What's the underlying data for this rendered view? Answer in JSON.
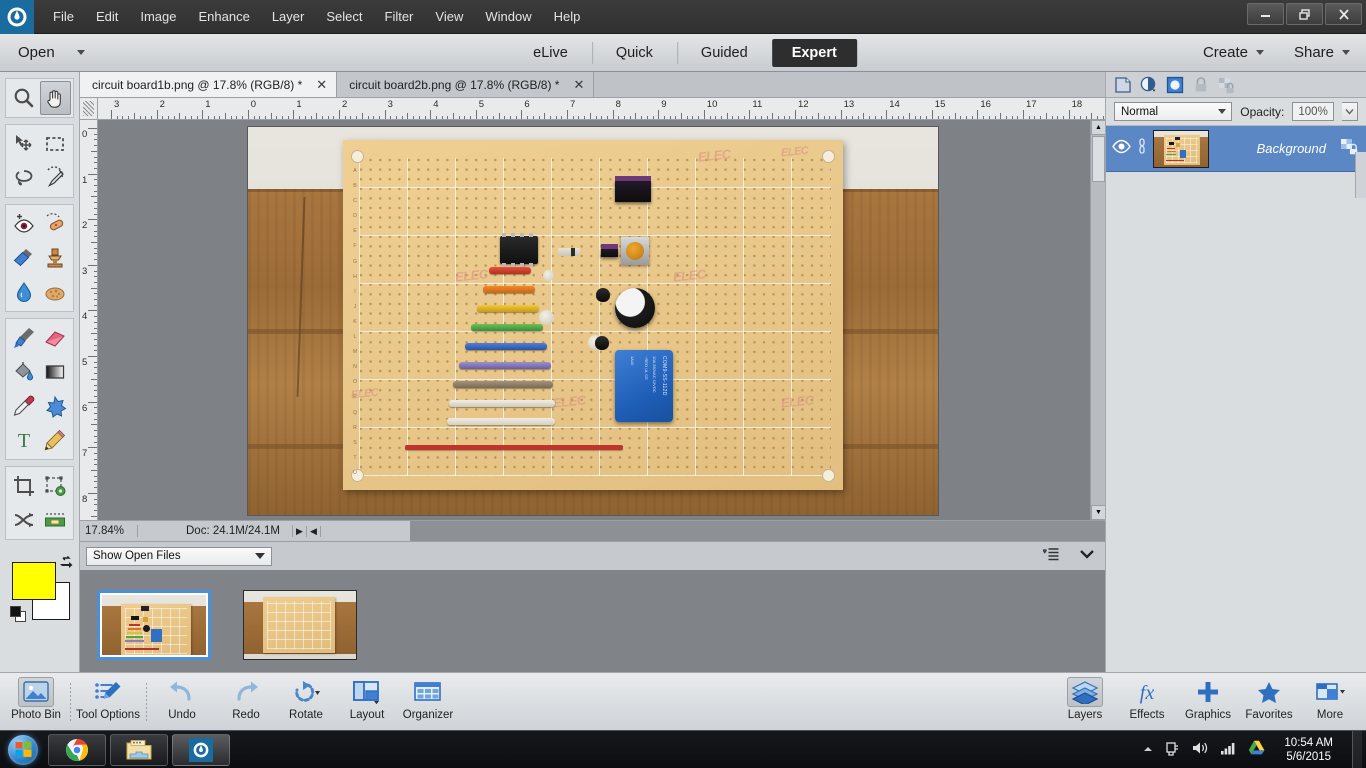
{
  "app": {
    "title": "Adobe Photoshop Elements",
    "logo_icon": "photoshop-elements-logo"
  },
  "menubar": {
    "items": [
      "File",
      "Edit",
      "Image",
      "Enhance",
      "Layer",
      "Select",
      "Filter",
      "View",
      "Window",
      "Help"
    ],
    "window_controls": [
      "minimize",
      "restore",
      "close"
    ]
  },
  "modebar": {
    "open_label": "Open",
    "tabs": [
      {
        "label": "eLive",
        "active": false
      },
      {
        "label": "Quick",
        "active": false
      },
      {
        "label": "Guided",
        "active": false
      },
      {
        "label": "Expert",
        "active": true
      }
    ],
    "create_label": "Create",
    "share_label": "Share"
  },
  "toolbar": {
    "groups": [
      {
        "tools": [
          {
            "name": "zoom-tool",
            "icon": "magnifier-icon",
            "active": false
          },
          {
            "name": "hand-tool",
            "icon": "hand-icon",
            "active": true
          }
        ]
      },
      {
        "tools": [
          {
            "name": "move-tool",
            "icon": "move-arrows-icon",
            "active": false
          },
          {
            "name": "rectangular-marquee-tool",
            "icon": "dashed-rectangle-icon",
            "active": false
          },
          {
            "name": "lasso-tool",
            "icon": "lasso-icon",
            "active": false
          },
          {
            "name": "quick-selection-tool",
            "icon": "magic-wand-icon",
            "active": false
          }
        ]
      },
      {
        "tools": [
          {
            "name": "red-eye-removal-tool",
            "icon": "eye-plus-icon",
            "active": false
          },
          {
            "name": "spot-healing-brush-tool",
            "icon": "healing-bandage-icon",
            "active": false
          },
          {
            "name": "smart-brush-tool",
            "icon": "paint-brush-blue-icon",
            "active": false
          },
          {
            "name": "clone-stamp-tool",
            "icon": "rubber-stamp-icon",
            "active": false
          },
          {
            "name": "blur-tool",
            "icon": "water-drop-icon",
            "active": false
          },
          {
            "name": "sponge-tool",
            "icon": "sponge-icon",
            "active": false
          }
        ]
      },
      {
        "tools": [
          {
            "name": "brush-tool",
            "icon": "paintbrush-icon",
            "active": false
          },
          {
            "name": "eraser-tool",
            "icon": "eraser-icon",
            "active": false
          },
          {
            "name": "paint-bucket-tool",
            "icon": "paint-bucket-icon",
            "active": false
          },
          {
            "name": "gradient-tool",
            "icon": "gradient-square-icon",
            "active": false
          },
          {
            "name": "color-picker-tool",
            "icon": "eyedropper-icon",
            "active": false
          },
          {
            "name": "custom-shape-tool",
            "icon": "blue-star-shape-icon",
            "active": false
          },
          {
            "name": "type-tool",
            "icon": "letter-t-icon",
            "active": false
          },
          {
            "name": "pencil-tool",
            "icon": "pencil-icon",
            "active": false
          }
        ]
      },
      {
        "tools": [
          {
            "name": "crop-tool",
            "icon": "crop-icon",
            "active": false
          },
          {
            "name": "recompose-tool",
            "icon": "transform-gear-icon",
            "active": false
          },
          {
            "name": "content-aware-move-tool",
            "icon": "swap-arrows-icon",
            "active": false
          },
          {
            "name": "straighten-tool",
            "icon": "straighten-level-icon",
            "active": false
          }
        ]
      }
    ],
    "colors": {
      "foreground": "#ffff00",
      "background": "#ffffff",
      "swap_icon": "swap-colors-icon",
      "default_icon": "default-colors-icon"
    }
  },
  "document_tabs": [
    {
      "label": "circuit board1b.png @ 17.8% (RGB/8) *",
      "active": true,
      "close_icon": "close-icon"
    },
    {
      "label": "circuit board2b.png @ 17.8% (RGB/8) *",
      "active": false,
      "close_icon": "close-icon"
    }
  ],
  "rulers": {
    "unit": "inches",
    "horizontal_labels": [
      "3",
      "2",
      "1",
      "0",
      "1",
      "2",
      "3",
      "4",
      "5",
      "6",
      "7",
      "8",
      "9",
      "10",
      "11",
      "12",
      "13",
      "14",
      "15",
      "16",
      "17",
      "18"
    ],
    "vertical_labels": [
      "0",
      "1",
      "2",
      "3",
      "4",
      "5",
      "6",
      "7",
      "8"
    ]
  },
  "canvas": {
    "image_name": "circuit board1b.png",
    "description": "Photo of a perfboard / prototyping circuit board with components, lying on wooden planks",
    "board_label_letters": "ABCDEFGHIJKLMNOPQRSTU",
    "components": [
      {
        "name": "dip-ic-chip",
        "type": "ic"
      },
      {
        "name": "black-rectangular-component",
        "type": "block"
      },
      {
        "name": "trimmer-potentiometer",
        "type": "trimmer"
      },
      {
        "name": "electrolytic-capacitor",
        "type": "elec"
      },
      {
        "name": "blue-box-capacitor",
        "type": "bluecap",
        "text": "COM9-SS-112D"
      },
      {
        "name": "ceramic-disc-capacitor",
        "type": "disc"
      },
      {
        "name": "diode",
        "type": "diode"
      },
      {
        "name": "transistor-to92",
        "type": "to92"
      }
    ],
    "resistor_colors": [
      "#c0352b",
      "#d9561f",
      "#e8a317",
      "#d9dc3b",
      "#4aa84a",
      "#3f6fc4",
      "#8b7fb8",
      "#7a6a58",
      "#d8d4c9"
    ]
  },
  "statusbar": {
    "zoom": "17.84%",
    "doc_info": "Doc: 24.1M/24.1M",
    "menu_icon": "triangle-right-icon",
    "scroll_icon": "triangle-left-icon"
  },
  "photobin": {
    "filter_label": "Show Open Files",
    "options_icon": "panel-menu-icon",
    "collapse_icon": "chevron-down-icon",
    "thumbnails": [
      {
        "name": "circuit board1b.png",
        "selected": true
      },
      {
        "name": "circuit board2b.png",
        "selected": false
      }
    ]
  },
  "layers_panel": {
    "toolbar_icons": [
      {
        "name": "new-layer-icon"
      },
      {
        "name": "adjustment-layer-icon"
      },
      {
        "name": "layer-mask-icon"
      },
      {
        "name": "lock-icon"
      },
      {
        "name": "lock-transparency-icon"
      },
      {
        "name": "delete-layer-icon"
      },
      {
        "name": "panel-menu-icon"
      }
    ],
    "blend_mode": "Normal",
    "opacity_label": "Opacity:",
    "opacity_value": "100%",
    "layers": [
      {
        "name": "Background",
        "visible": true,
        "locked": true,
        "selected": true,
        "visibility_icon": "eye-icon",
        "link_icon": "link-icon",
        "lock_badge_icon": "lock-checker-icon"
      }
    ]
  },
  "app_bottom_bar": {
    "left_buttons": [
      {
        "label": "Photo Bin",
        "icon": "photo-bin-icon",
        "active": true
      },
      {
        "label": "Tool Options",
        "icon": "tool-options-icon",
        "active": false
      },
      {
        "label": "Undo",
        "icon": "undo-arrow-icon",
        "active": false
      },
      {
        "label": "Redo",
        "icon": "redo-arrow-icon",
        "active": false
      },
      {
        "label": "Rotate",
        "icon": "rotate-icon",
        "active": false
      },
      {
        "label": "Layout",
        "icon": "layout-icon",
        "active": false
      },
      {
        "label": "Organizer",
        "icon": "organizer-grid-icon",
        "active": false
      }
    ],
    "right_buttons": [
      {
        "label": "Layers",
        "icon": "layers-stack-icon",
        "active": true
      },
      {
        "label": "Effects",
        "icon": "fx-icon",
        "active": false
      },
      {
        "label": "Graphics",
        "icon": "plus-icon",
        "active": false
      },
      {
        "label": "Favorites",
        "icon": "star-icon",
        "active": false
      },
      {
        "label": "More",
        "icon": "more-panel-icon",
        "active": false
      }
    ]
  },
  "windows_taskbar": {
    "start_icon": "windows-start-orb",
    "items": [
      {
        "name": "google-chrome",
        "icon": "chrome-icon",
        "active": false
      },
      {
        "name": "windows-explorer",
        "icon": "folder-icon",
        "active": false
      },
      {
        "name": "photoshop-elements",
        "icon": "photoshop-elements-icon",
        "active": true
      }
    ],
    "tray": [
      {
        "name": "show-hidden-icons",
        "icon": "chevron-up-icon"
      },
      {
        "name": "safely-remove-hardware",
        "icon": "usb-eject-icon"
      },
      {
        "name": "volume",
        "icon": "speaker-icon"
      },
      {
        "name": "network",
        "icon": "signal-bars-icon"
      },
      {
        "name": "google-drive",
        "icon": "google-drive-icon"
      }
    ],
    "time": "10:54 AM",
    "date": "5/6/2015"
  }
}
